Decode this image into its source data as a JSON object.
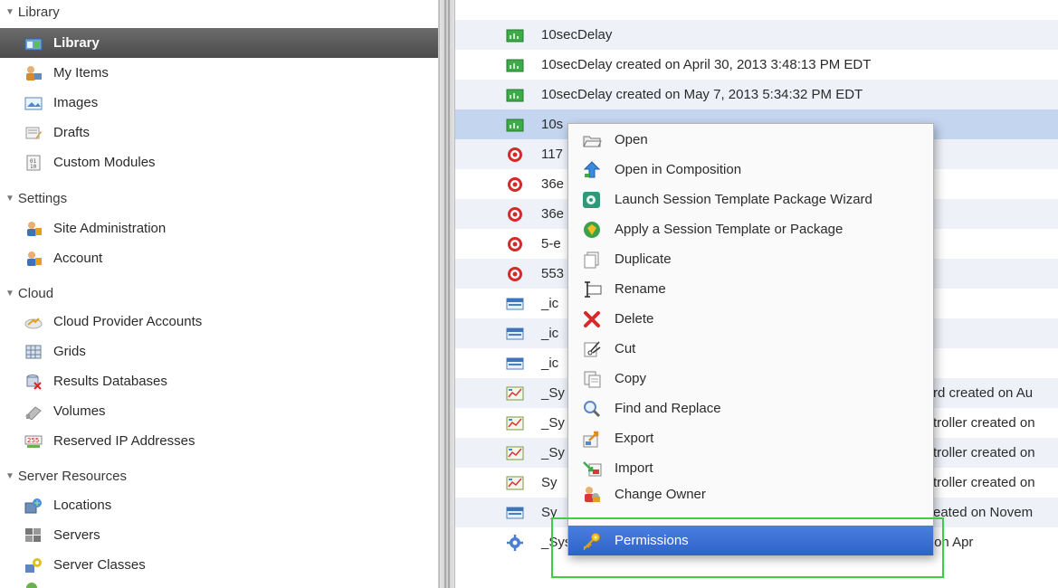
{
  "sidebar": {
    "sections": [
      {
        "label": "Library",
        "items": [
          {
            "label": "Library",
            "icon": "library-icon",
            "selected": true
          },
          {
            "label": "My Items",
            "icon": "my-items-icon"
          },
          {
            "label": "Images",
            "icon": "images-icon"
          },
          {
            "label": "Drafts",
            "icon": "drafts-icon"
          },
          {
            "label": "Custom Modules",
            "icon": "custom-modules-icon"
          }
        ]
      },
      {
        "label": "Settings",
        "items": [
          {
            "label": "Site Administration",
            "icon": "site-admin-icon"
          },
          {
            "label": "Account",
            "icon": "account-icon"
          }
        ]
      },
      {
        "label": "Cloud",
        "items": [
          {
            "label": "Cloud Provider Accounts",
            "icon": "cloud-provider-icon"
          },
          {
            "label": "Grids",
            "icon": "grids-icon"
          },
          {
            "label": "Results Databases",
            "icon": "results-db-icon"
          },
          {
            "label": "Volumes",
            "icon": "volumes-icon"
          },
          {
            "label": "Reserved IP Addresses",
            "icon": "reserved-ip-icon"
          }
        ]
      },
      {
        "label": "Server Resources",
        "items": [
          {
            "label": "Locations",
            "icon": "locations-icon"
          },
          {
            "label": "Servers",
            "icon": "servers-icon"
          },
          {
            "label": "Server Classes",
            "icon": "server-classes-icon"
          }
        ]
      }
    ]
  },
  "list": {
    "rows": [
      {
        "text": "10secDelay",
        "tail": "",
        "icon": "composition-icon"
      },
      {
        "text": "10secDelay created on April 30, 2013 3:48:13 PM EDT",
        "tail": "",
        "icon": "composition-icon"
      },
      {
        "text": "10secDelay created on May 7, 2013 5:34:32 PM EDT",
        "tail": "",
        "icon": "composition-icon"
      },
      {
        "text": "10s",
        "tail": "",
        "icon": "composition-icon",
        "selected": true
      },
      {
        "text": "117",
        "tail": "",
        "icon": "target-icon"
      },
      {
        "text": "36e",
        "tail": "",
        "icon": "target-icon"
      },
      {
        "text": "36e",
        "tail": "",
        "icon": "target-icon"
      },
      {
        "text": "5-e",
        "tail": "",
        "icon": "target-icon"
      },
      {
        "text": "553",
        "tail": "",
        "icon": "target-icon"
      },
      {
        "text": "_ic",
        "tail": "",
        "icon": "image-file-icon"
      },
      {
        "text": "_ic",
        "tail": "",
        "icon": "image-file-icon"
      },
      {
        "text": "_ic",
        "tail": "",
        "icon": "image-file-icon"
      },
      {
        "text": "_Sy",
        "tail": "rd created on Au",
        "icon": "dashboard-icon"
      },
      {
        "text": "_Sy",
        "tail": "troller created on",
        "icon": "dashboard-icon"
      },
      {
        "text": "_Sy",
        "tail": "troller created on",
        "icon": "dashboard-icon"
      },
      {
        "text": "Sy",
        "tail": "troller created on",
        "icon": "dashboard-icon"
      },
      {
        "text": "Sy",
        "tail": "eated on Novem",
        "icon": "image-file-icon"
      },
      {
        "text": "_System Objects_Widgets_Virtual User Ramp Controller created on Apr",
        "tail": "",
        "icon": "gear-widget-icon"
      }
    ]
  },
  "context_menu": {
    "items": [
      {
        "label": "Open",
        "icon": "open-folder-icon"
      },
      {
        "label": "Open in Composition",
        "icon": "open-composition-icon"
      },
      {
        "label": "Launch Session Template Package Wizard",
        "icon": "wizard-icon"
      },
      {
        "label": "Apply a Session Template or Package",
        "icon": "apply-template-icon"
      },
      {
        "label": "Duplicate",
        "icon": "duplicate-icon"
      },
      {
        "label": "Rename",
        "icon": "rename-icon"
      },
      {
        "label": "Delete",
        "icon": "delete-icon"
      },
      {
        "label": "Cut",
        "icon": "cut-icon"
      },
      {
        "label": "Copy",
        "icon": "copy-icon"
      },
      {
        "label": "Find and Replace",
        "icon": "find-replace-icon"
      },
      {
        "label": "Export",
        "icon": "export-icon"
      },
      {
        "label": "Import",
        "icon": "import-icon"
      },
      {
        "label": "Change Owner",
        "icon": "change-owner-icon"
      },
      {
        "label": "Permissions",
        "icon": "key-icon",
        "highlighted": true
      }
    ]
  },
  "colors": {
    "selection_blue": "#c4d5ef",
    "menu_highlight": "#3a6fd4",
    "annotation_green": "#3ecf3e"
  }
}
